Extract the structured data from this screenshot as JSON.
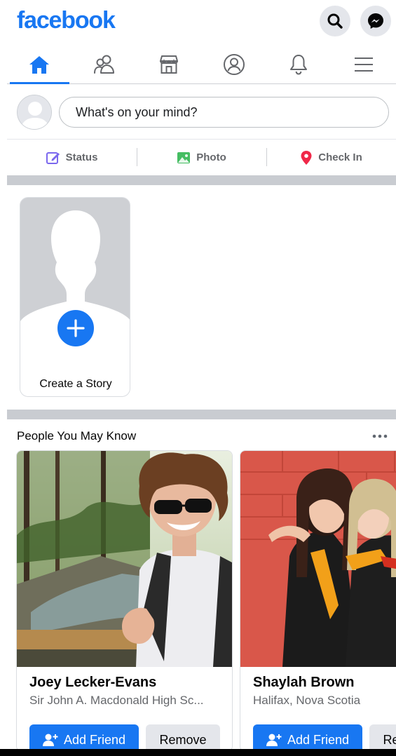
{
  "app": {
    "logo_text": "facebook",
    "brand_color": "#1877f2",
    "header_icons": [
      "search-icon",
      "messenger-icon"
    ]
  },
  "tabs": [
    {
      "name": "home",
      "icon": "home-icon",
      "active": true
    },
    {
      "name": "friends",
      "icon": "friends-icon",
      "active": false
    },
    {
      "name": "marketplace",
      "icon": "marketplace-icon",
      "active": false
    },
    {
      "name": "profile",
      "icon": "profile-icon",
      "active": false
    },
    {
      "name": "notifications",
      "icon": "bell-icon",
      "active": false
    },
    {
      "name": "menu",
      "icon": "hamburger-menu-icon",
      "active": false
    }
  ],
  "composer": {
    "placeholder": "What's on your mind?"
  },
  "post_actions": [
    {
      "label": "Status",
      "icon": "edit-icon",
      "color": "#7b68ee"
    },
    {
      "label": "Photo",
      "icon": "photo-icon",
      "color": "#45bd62"
    },
    {
      "label": "Check In",
      "icon": "location-pin-icon",
      "color": "#f02849"
    }
  ],
  "story": {
    "label": "Create a Story"
  },
  "pymk": {
    "title": "People You May Know",
    "people": [
      {
        "name": "Joey Lecker-Evans",
        "subtitle": "Sir John A. Macdonald High Sc...",
        "add_label": "Add Friend",
        "remove_label": "Remove"
      },
      {
        "name": "Shaylah Brown",
        "subtitle": "Halifax, Nova Scotia",
        "add_label": "Add Friend",
        "remove_label": "Remove"
      }
    ]
  }
}
